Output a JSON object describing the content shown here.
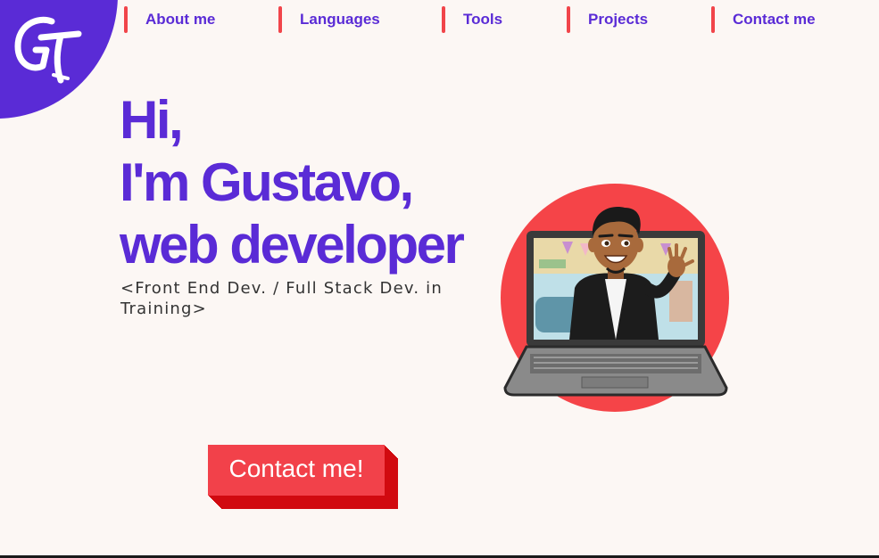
{
  "logo": {
    "text": "GT",
    "icon": "gt-monogram-logo",
    "bg_color": "#5a2bd6"
  },
  "nav": {
    "items": [
      {
        "label": "About me"
      },
      {
        "label": "Languages"
      },
      {
        "label": "Tools"
      },
      {
        "label": "Projects"
      },
      {
        "label": "Contact me"
      }
    ],
    "accent_color": "#f1454a"
  },
  "hero": {
    "line1": "Hi,",
    "line2": "I'm Gustavo,",
    "line3": "web developer",
    "subtitle": "<Front End Dev. / Full Stack Dev. in Training>",
    "text_color": "#5a2bd6"
  },
  "cta": {
    "label": "Contact me!",
    "color": "#f2414a"
  },
  "illustration": {
    "icon": "avatar-waving-from-laptop",
    "circle_color": "#f54448"
  }
}
